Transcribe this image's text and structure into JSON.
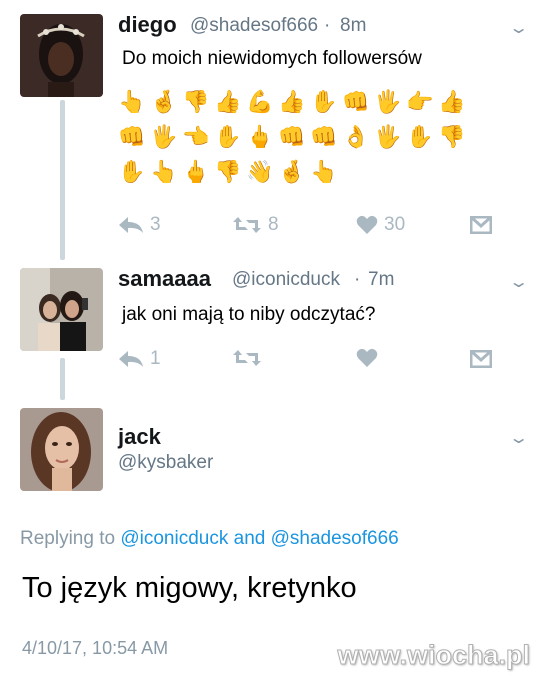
{
  "tweets": [
    {
      "name": "diego",
      "handle": "@shadesof666",
      "separator": "·",
      "time": "8m",
      "text": "Do moich niewidomych followersów",
      "reply_count": "3",
      "retweet_count": "8",
      "like_count": "30"
    },
    {
      "name": "samaaaa",
      "handle": "@iconicduck",
      "separator": "·",
      "time": "7m",
      "text": "jak oni mają to niby odczytać?",
      "reply_count": "1"
    }
  ],
  "emoji_rows": [
    [
      "👆",
      "🤞",
      "👎",
      "👍",
      "💪",
      "👍",
      "✋",
      "👊",
      "🖐",
      "👉",
      "👍"
    ],
    [
      "👊",
      "🖐",
      "👈",
      "✋",
      "🖕",
      "👊",
      "👊",
      "👌",
      "🖐",
      "✋",
      "👎"
    ],
    [
      "✋",
      "👆",
      "🖕",
      "👎",
      "👋",
      "🤞",
      "👆"
    ]
  ],
  "reply": {
    "name": "jack",
    "handle": "@kysbaker",
    "replying_prefix": "Replying to",
    "replying_user1": "@iconicduck",
    "replying_and": "and",
    "replying_user2": "@shadesof666",
    "text": "To język migowy, kretynko",
    "date": "4/10/17, 10:54 AM"
  },
  "watermark": "www.wiocha.pl",
  "colors": {
    "accent_blue": "#1b95e0",
    "gray": "#657786",
    "icon_gray": "#aab8c2",
    "skin": "#e8b184"
  }
}
